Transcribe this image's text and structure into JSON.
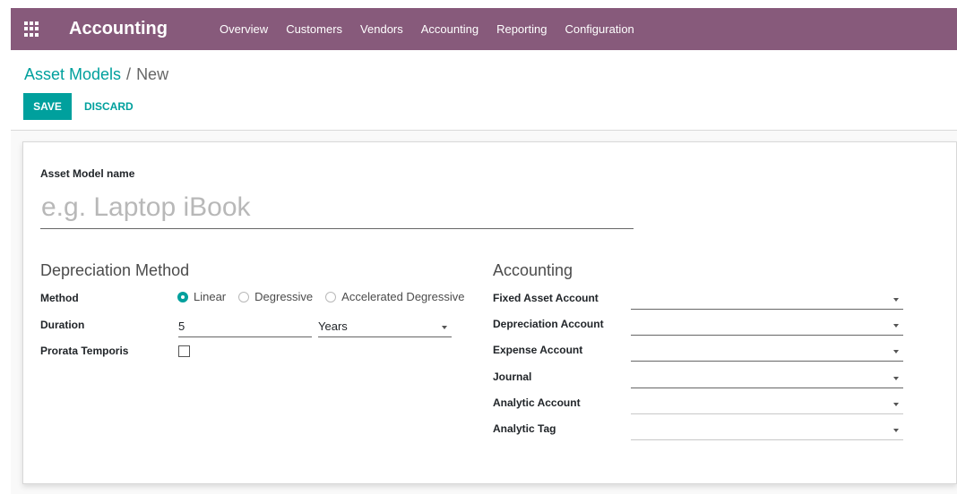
{
  "navbar": {
    "brand": "Accounting",
    "menu": [
      "Overview",
      "Customers",
      "Vendors",
      "Accounting",
      "Reporting",
      "Configuration"
    ]
  },
  "breadcrumb": {
    "parent": "Asset Models",
    "separator": "/",
    "current": "New"
  },
  "buttons": {
    "save": "SAVE",
    "discard": "DISCARD"
  },
  "form": {
    "name_label": "Asset Model name",
    "name_placeholder": "e.g. Laptop iBook",
    "depreciation": {
      "title": "Depreciation Method",
      "method_label": "Method",
      "method_options": [
        "Linear",
        "Degressive",
        "Accelerated Degressive"
      ],
      "method_selected": "Linear",
      "duration_label": "Duration",
      "duration_value": "5",
      "duration_unit": "Years",
      "prorata_label": "Prorata Temporis",
      "prorata_checked": false
    },
    "accounting": {
      "title": "Accounting",
      "fields": [
        {
          "label": "Fixed Asset Account",
          "value": ""
        },
        {
          "label": "Depreciation Account",
          "value": ""
        },
        {
          "label": "Expense Account",
          "value": ""
        },
        {
          "label": "Journal",
          "value": ""
        },
        {
          "label": "Analytic Account",
          "value": ""
        },
        {
          "label": "Analytic Tag",
          "value": ""
        }
      ]
    }
  },
  "colors": {
    "navbar": "#875a7b",
    "primary": "#00a09d"
  }
}
